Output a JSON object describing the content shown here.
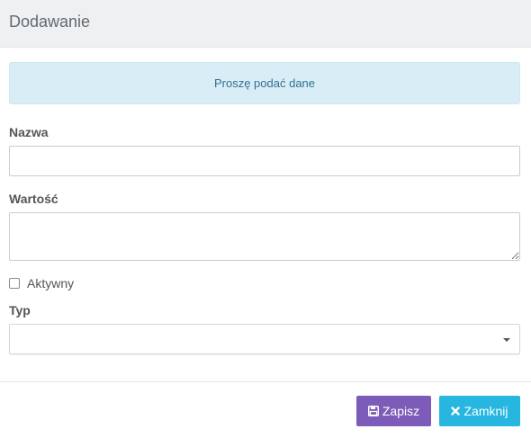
{
  "modal": {
    "title": "Dodawanie"
  },
  "alert": {
    "text": "Proszę podać dane",
    "color": "#d9edf7"
  },
  "form": {
    "name": {
      "label": "Nazwa",
      "value": "",
      "placeholder": ""
    },
    "value": {
      "label": "Wartość",
      "value": "",
      "placeholder": ""
    },
    "active": {
      "label": "Aktywny",
      "checked": false
    },
    "type": {
      "label": "Typ",
      "selected": ""
    }
  },
  "footer": {
    "save_label": "Zapisz",
    "save_icon": "floppy-disk-icon",
    "save_color": "#7c5cb8",
    "close_label": "Zamknij",
    "close_icon": "close-x-icon",
    "close_color": "#26b6e0"
  }
}
